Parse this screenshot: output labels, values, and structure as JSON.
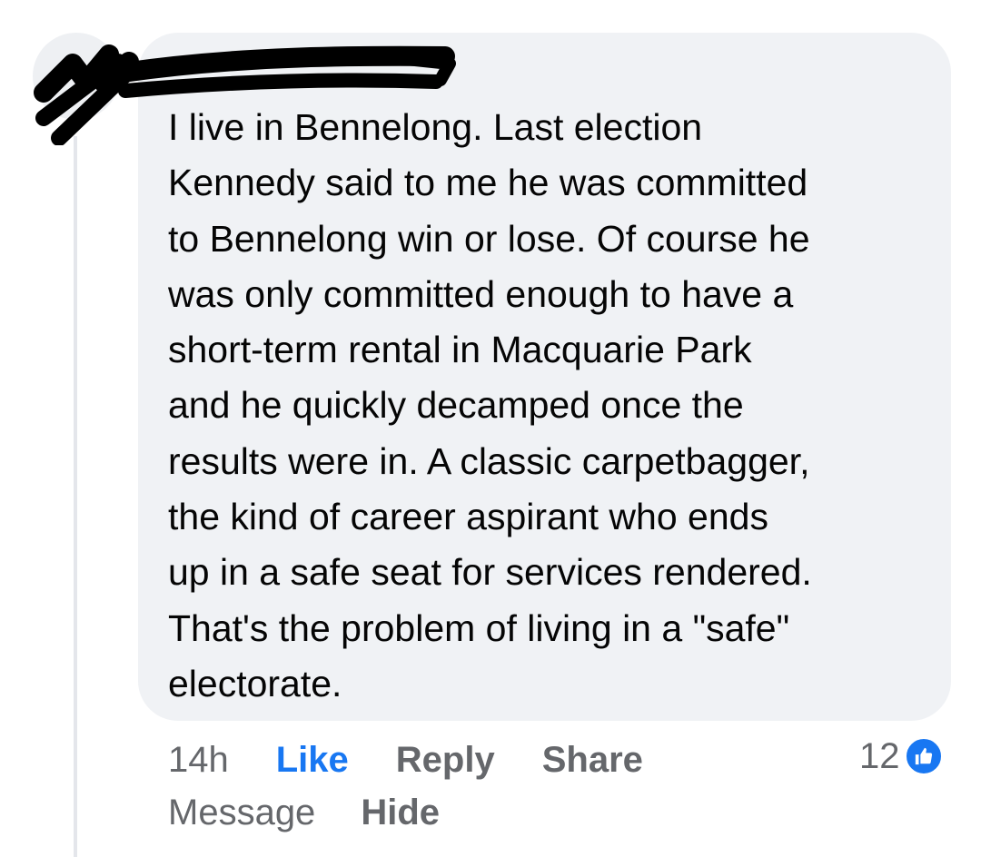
{
  "comment": {
    "text": "I live in Bennelong. Last election\nKennedy said to me he was committed\nto Bennelong win or lose. Of course he\nwas only committed enough to have a\nshort-term rental in Macquarie Park\nand he quickly decamped once the\nresults were in. A classic carpetbagger,\nthe kind of career aspirant who ends\nup in a safe seat for services rendered.\nThat's the problem of living in a \"safe\"\nelectorate."
  },
  "actions": {
    "time": "14h",
    "like": "Like",
    "reply": "Reply",
    "share": "Share",
    "message": "Message",
    "hide": "Hide"
  },
  "reactions": {
    "count": "12",
    "icon": "thumbs-up-icon"
  },
  "colors": {
    "bubble": "#f0f2f5",
    "accent": "#1877f2",
    "muted": "#65676b",
    "text": "#050505"
  }
}
